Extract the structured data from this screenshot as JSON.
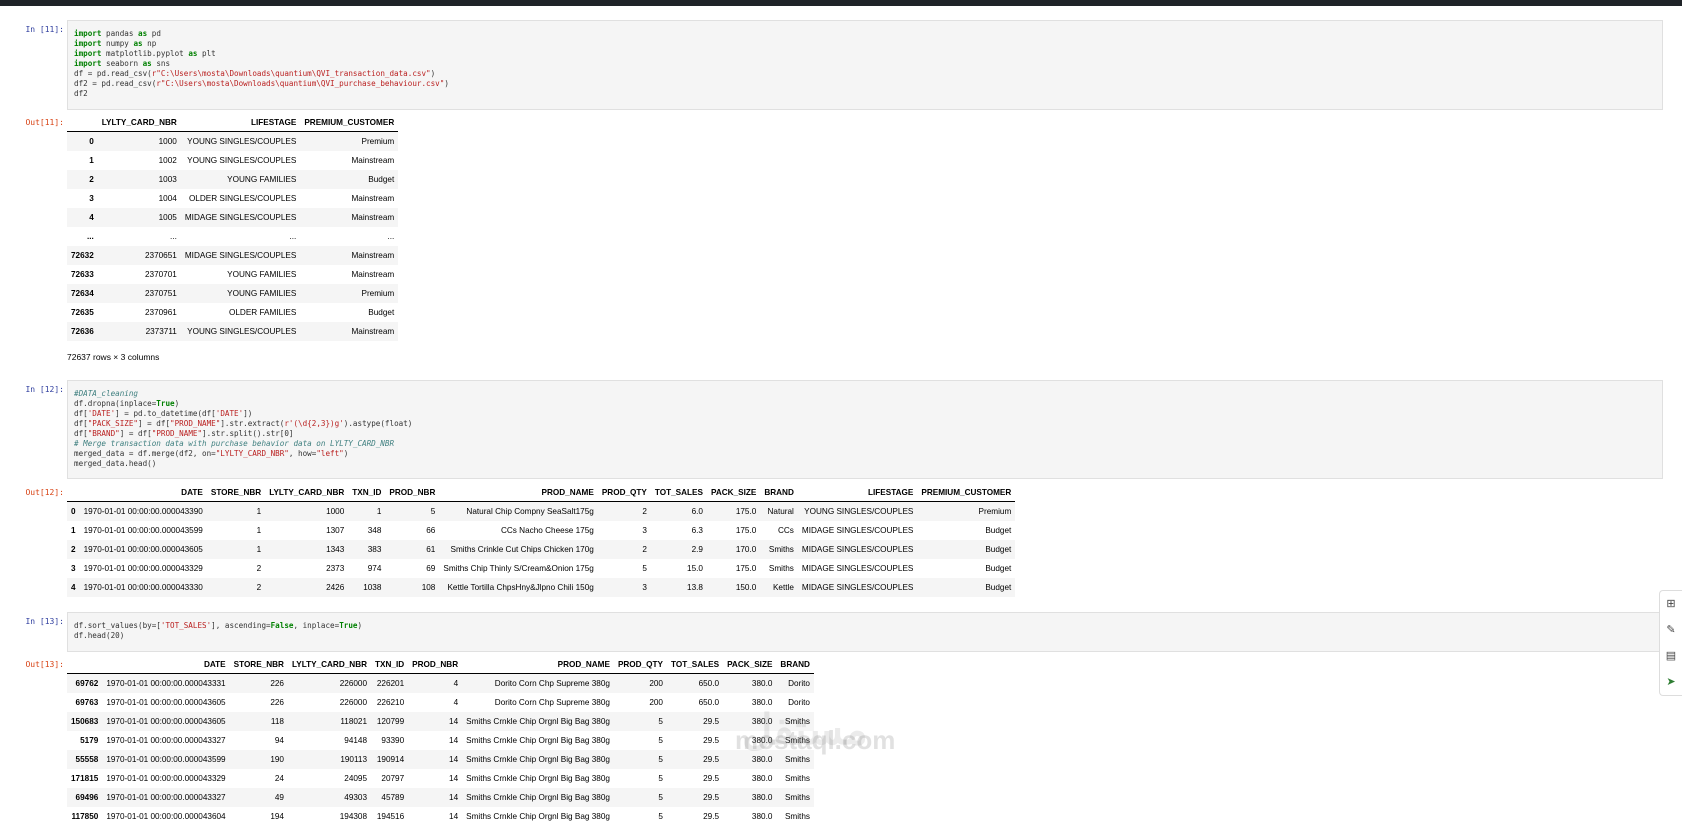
{
  "cells": [
    {
      "in_prompt": "In [11]:",
      "out_prompt": "Out[11]:",
      "code_lines": [
        "import pandas as pd",
        "import numpy as np",
        "import matplotlib.pyplot as plt",
        "import seaborn as sns",
        "df = pd.read_csv(r\"C:\\Users\\mosta\\Downloads\\quantium\\QVI_transaction_data.csv\")",
        "df2 = pd.read_csv(r\"C:\\Users\\mosta\\Downloads\\quantium\\QVI_purchase_behaviour.csv\")",
        "df2"
      ],
      "table": {
        "columns": [
          "",
          "LYLTY_CARD_NBR",
          "LIFESTAGE",
          "PREMIUM_CUSTOMER"
        ],
        "rows": [
          [
            "0",
            "1000",
            "YOUNG SINGLES/COUPLES",
            "Premium"
          ],
          [
            "1",
            "1002",
            "YOUNG SINGLES/COUPLES",
            "Mainstream"
          ],
          [
            "2",
            "1003",
            "YOUNG FAMILIES",
            "Budget"
          ],
          [
            "3",
            "1004",
            "OLDER SINGLES/COUPLES",
            "Mainstream"
          ],
          [
            "4",
            "1005",
            "MIDAGE SINGLES/COUPLES",
            "Mainstream"
          ],
          [
            "...",
            "...",
            "...",
            "..."
          ],
          [
            "72632",
            "2370651",
            "MIDAGE SINGLES/COUPLES",
            "Mainstream"
          ],
          [
            "72633",
            "2370701",
            "YOUNG FAMILIES",
            "Mainstream"
          ],
          [
            "72634",
            "2370751",
            "YOUNG FAMILIES",
            "Premium"
          ],
          [
            "72635",
            "2370961",
            "OLDER FAMILIES",
            "Budget"
          ],
          [
            "72636",
            "2373711",
            "YOUNG SINGLES/COUPLES",
            "Mainstream"
          ]
        ]
      },
      "footer": "72637 rows × 3 columns"
    },
    {
      "in_prompt": "In [12]:",
      "out_prompt": "Out[12]:",
      "code_lines": [
        "#DATA_cleaning",
        "df.dropna(inplace=True)",
        "df['DATE'] = pd.to_datetime(df['DATE'])",
        "df[\"PACK_SIZE\"] = df[\"PROD_NAME\"].str.extract(r'(\\d{2,3})g').astype(float)",
        "df[\"BRAND\"] = df[\"PROD_NAME\"].str.split().str[0]",
        "# Merge transaction data with purchase behavior data on LYLTY_CARD_NBR",
        "merged_data = df.merge(df2, on=\"LYLTY_CARD_NBR\", how=\"left\")",
        "merged_data.head()"
      ],
      "table": {
        "columns": [
          "",
          "DATE",
          "STORE_NBR",
          "LYLTY_CARD_NBR",
          "TXN_ID",
          "PROD_NBR",
          "PROD_NAME",
          "PROD_QTY",
          "TOT_SALES",
          "PACK_SIZE",
          "BRAND",
          "LIFESTAGE",
          "PREMIUM_CUSTOMER"
        ],
        "rows": [
          [
            "0",
            "1970-01-01 00:00:00.000043390",
            "1",
            "1000",
            "1",
            "5",
            "Natural Chip Compny SeaSalt175g",
            "2",
            "6.0",
            "175.0",
            "Natural",
            "YOUNG SINGLES/COUPLES",
            "Premium"
          ],
          [
            "1",
            "1970-01-01 00:00:00.000043599",
            "1",
            "1307",
            "348",
            "66",
            "CCs Nacho Cheese 175g",
            "3",
            "6.3",
            "175.0",
            "CCs",
            "MIDAGE SINGLES/COUPLES",
            "Budget"
          ],
          [
            "2",
            "1970-01-01 00:00:00.000043605",
            "1",
            "1343",
            "383",
            "61",
            "Smiths Crinkle Cut Chips Chicken 170g",
            "2",
            "2.9",
            "170.0",
            "Smiths",
            "MIDAGE SINGLES/COUPLES",
            "Budget"
          ],
          [
            "3",
            "1970-01-01 00:00:00.000043329",
            "2",
            "2373",
            "974",
            "69",
            "Smiths Chip Thinly S/Cream&Onion 175g",
            "5",
            "15.0",
            "175.0",
            "Smiths",
            "MIDAGE SINGLES/COUPLES",
            "Budget"
          ],
          [
            "4",
            "1970-01-01 00:00:00.000043330",
            "2",
            "2426",
            "1038",
            "108",
            "Kettle Tortilla ChpsHny&Jlpno Chili 150g",
            "3",
            "13.8",
            "150.0",
            "Kettle",
            "MIDAGE SINGLES/COUPLES",
            "Budget"
          ]
        ]
      }
    },
    {
      "in_prompt": "In [13]:",
      "out_prompt": "Out[13]:",
      "code_lines": [
        "df.sort_values(by=['TOT_SALES'], ascending=False, inplace=True)",
        "df.head(20)"
      ],
      "table": {
        "columns": [
          "",
          "DATE",
          "STORE_NBR",
          "LYLTY_CARD_NBR",
          "TXN_ID",
          "PROD_NBR",
          "PROD_NAME",
          "PROD_QTY",
          "TOT_SALES",
          "PACK_SIZE",
          "BRAND"
        ],
        "rows": [
          [
            "69762",
            "1970-01-01 00:00:00.000043331",
            "226",
            "226000",
            "226201",
            "4",
            "Dorito Corn Chp Supreme 380g",
            "200",
            "650.0",
            "380.0",
            "Dorito"
          ],
          [
            "69763",
            "1970-01-01 00:00:00.000043605",
            "226",
            "226000",
            "226210",
            "4",
            "Dorito Corn Chp Supreme 380g",
            "200",
            "650.0",
            "380.0",
            "Dorito"
          ],
          [
            "150683",
            "1970-01-01 00:00:00.000043605",
            "118",
            "118021",
            "120799",
            "14",
            "Smiths Crnkle Chip Orgnl Big Bag 380g",
            "5",
            "29.5",
            "380.0",
            "Smiths"
          ],
          [
            "5179",
            "1970-01-01 00:00:00.000043327",
            "94",
            "94148",
            "93390",
            "14",
            "Smiths Crnkle Chip Orgnl Big Bag 380g",
            "5",
            "29.5",
            "380.0",
            "Smiths"
          ],
          [
            "55558",
            "1970-01-01 00:00:00.000043599",
            "190",
            "190113",
            "190914",
            "14",
            "Smiths Crnkle Chip Orgnl Big Bag 380g",
            "5",
            "29.5",
            "380.0",
            "Smiths"
          ],
          [
            "171815",
            "1970-01-01 00:00:00.000043329",
            "24",
            "24095",
            "20797",
            "14",
            "Smiths Crnkle Chip Orgnl Big Bag 380g",
            "5",
            "29.5",
            "380.0",
            "Smiths"
          ],
          [
            "69496",
            "1970-01-01 00:00:00.000043327",
            "49",
            "49303",
            "45789",
            "14",
            "Smiths Crnkle Chip Orgnl Big Bag 380g",
            "5",
            "29.5",
            "380.0",
            "Smiths"
          ],
          [
            "117850",
            "1970-01-01 00:00:00.000043604",
            "194",
            "194308",
            "194516",
            "14",
            "Smiths Crnkle Chip Orgnl Big Bag 380g",
            "5",
            "29.5",
            "380.0",
            "Smiths"
          ]
        ]
      }
    }
  ],
  "watermark": {
    "arabic": "مستقل",
    "latin": "mostaql.com"
  },
  "side_tools": [
    "add-cell-icon",
    "edit-icon",
    "format-icon",
    "run-icon"
  ]
}
